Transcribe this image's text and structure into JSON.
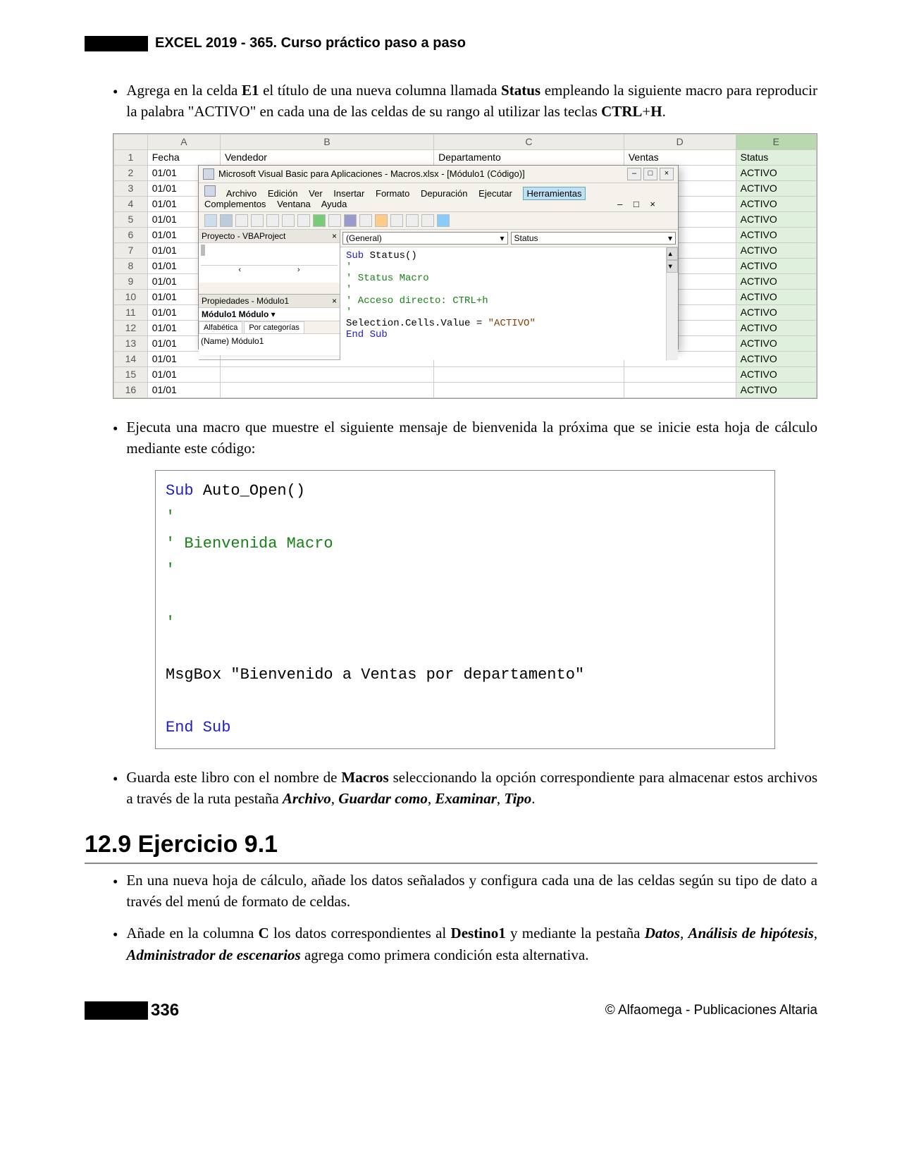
{
  "header": "EXCEL 2019 - 365. Curso práctico paso a paso",
  "bullet1": {
    "p1": "Agrega en la celda ",
    "b1": "E1",
    "p2": " el título de una nueva columna llamada ",
    "b2": "Status",
    "p3": " empleando la siguiente macro para reproducir la palabra \"ACTIVO\" en cada una de las celdas de su rango al utilizar las teclas ",
    "b3": "CTRL",
    "p4": "+",
    "b4": "H",
    "p5": "."
  },
  "excel": {
    "cols": [
      "A",
      "B",
      "C",
      "D",
      "E"
    ],
    "headers": {
      "A": "Fecha",
      "B": "Vendedor",
      "C": "Departamento",
      "D": "Ventas",
      "E": "Status"
    },
    "rows": [
      {
        "n": 1
      },
      {
        "n": 2
      },
      {
        "n": 3
      },
      {
        "n": 4
      },
      {
        "n": 5
      },
      {
        "n": 6
      },
      {
        "n": 7
      },
      {
        "n": 8
      },
      {
        "n": 9
      },
      {
        "n": 10
      },
      {
        "n": 11
      },
      {
        "n": 12
      },
      {
        "n": 13
      },
      {
        "n": 14
      },
      {
        "n": 15
      },
      {
        "n": 16
      }
    ],
    "dateval": "01/01",
    "status": "ACTIVO"
  },
  "vba": {
    "title": "Microsoft Visual Basic para Aplicaciones - Macros.xlsx - [Módulo1 (Código)]",
    "menu": [
      "Archivo",
      "Edición",
      "Ver",
      "Insertar",
      "Formato",
      "Depuración",
      "Ejecutar"
    ],
    "menu_hl": "Herramientas",
    "menu2": [
      "Complementos",
      "Ventana",
      "Ayuda"
    ],
    "proj_title": "Proyecto - VBAProject",
    "props_title": "Propiedades - Módulo1",
    "mod_label": "Módulo1 Módulo",
    "tab1": "Alfabética",
    "tab2": "Por categorías",
    "prop_row": "(Name) Módulo1",
    "combo1": "(General)",
    "combo2": "Status",
    "code": {
      "l1a": "Sub ",
      "l1b": "Status()",
      "l2": "'",
      "l3": "' Status Macro",
      "l4": "'",
      "l5": "' Acceso directo: CTRL+h",
      "l6": "'",
      "l7a": "   Selection.Cells.Value = ",
      "l7b": "\"ACTIVO\"",
      "l8": "End Sub"
    }
  },
  "bullet2": "Ejecuta una macro que muestre el siguiente mensaje de bienvenida la próxima que se inicie esta hoja de cálculo mediante este código:",
  "codebox": {
    "l1a": "Sub ",
    "l1b": "Auto_Open()",
    "l2": "'",
    "l3": "' Bienvenida Macro",
    "l4": "'",
    "l5": "'",
    "l6": "MsgBox \"Bienvenido a Ventas por departamento\"",
    "l7": "End Sub"
  },
  "bullet3": {
    "p1": "Guarda este libro con el nombre de ",
    "b1": "Macros",
    "p2": " seleccionando la opción correspondiente para almacenar estos archivos a través de la ruta pestaña ",
    "bi1": "Archivo",
    "c1": ", ",
    "bi2": "Guardar como",
    "c2": ", ",
    "bi3": "Examinar",
    "c3": ", ",
    "bi4": "Tipo",
    "c4": "."
  },
  "section": "12.9 Ejercicio 9.1",
  "bullet4": "En una nueva hoja de cálculo, añade los datos señalados y configura cada una de las celdas según su tipo de dato a través del menú de formato de celdas.",
  "bullet5": {
    "p1": "Añade en la columna ",
    "b1": "C",
    "p2": " los datos correspondientes al ",
    "b2": "Destino1",
    "p3": " y mediante la pestaña ",
    "bi1": "Datos",
    "c1": ", ",
    "bi2": "Análisis de hipótesis",
    "c2": ", ",
    "bi3": "Administrador de escenarios",
    "p4": " agrega como primera condición esta alternativa."
  },
  "footer": {
    "page": "336",
    "copy": "© Alfaomega - Publicaciones Altaria"
  }
}
